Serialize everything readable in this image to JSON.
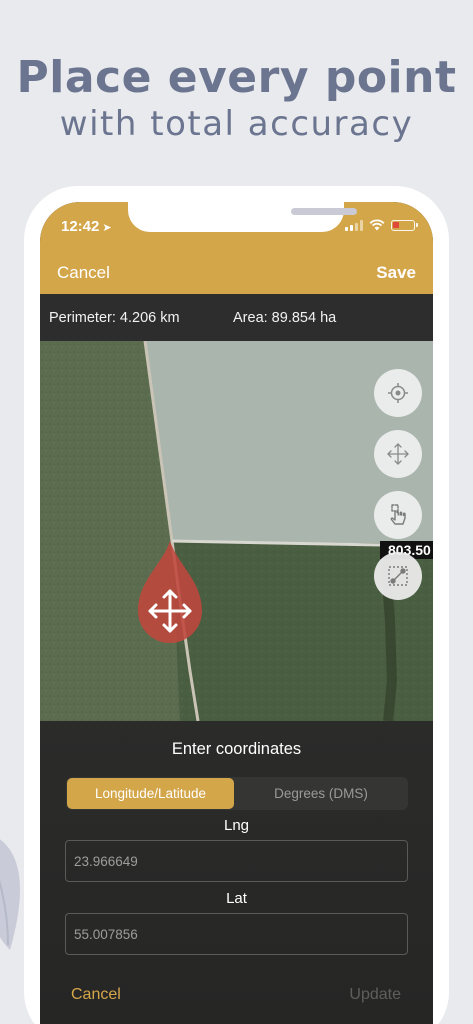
{
  "headline": {
    "line1": "Place every point",
    "line2": "with total accuracy"
  },
  "status_bar": {
    "time": "12:42"
  },
  "navbar": {
    "cancel_label": "Cancel",
    "save_label": "Save"
  },
  "measurements": {
    "perimeter": "Perimeter: 4.206 km",
    "area": "Area: 89.854 ha",
    "partial_label": "803.50"
  },
  "map_tools": [
    "locate-icon",
    "move-icon",
    "hand-pointer-icon",
    "edit-polygon-icon"
  ],
  "coordinates_panel": {
    "title": "Enter coordinates",
    "tabs": [
      "Longitude/Latitude",
      "Degrees (DMS)"
    ],
    "selected_tab": "Longitude/Latitude",
    "lng_label": "Lng",
    "lng_value": "23.966649",
    "lat_label": "Lat",
    "lat_value": "55.007856",
    "cancel_label": "Cancel",
    "update_label": "Update"
  },
  "colors": {
    "accent": "#d4a64a",
    "headline": "#6b7590",
    "panel": "#2b2b2a",
    "marker": "#c0473e"
  }
}
